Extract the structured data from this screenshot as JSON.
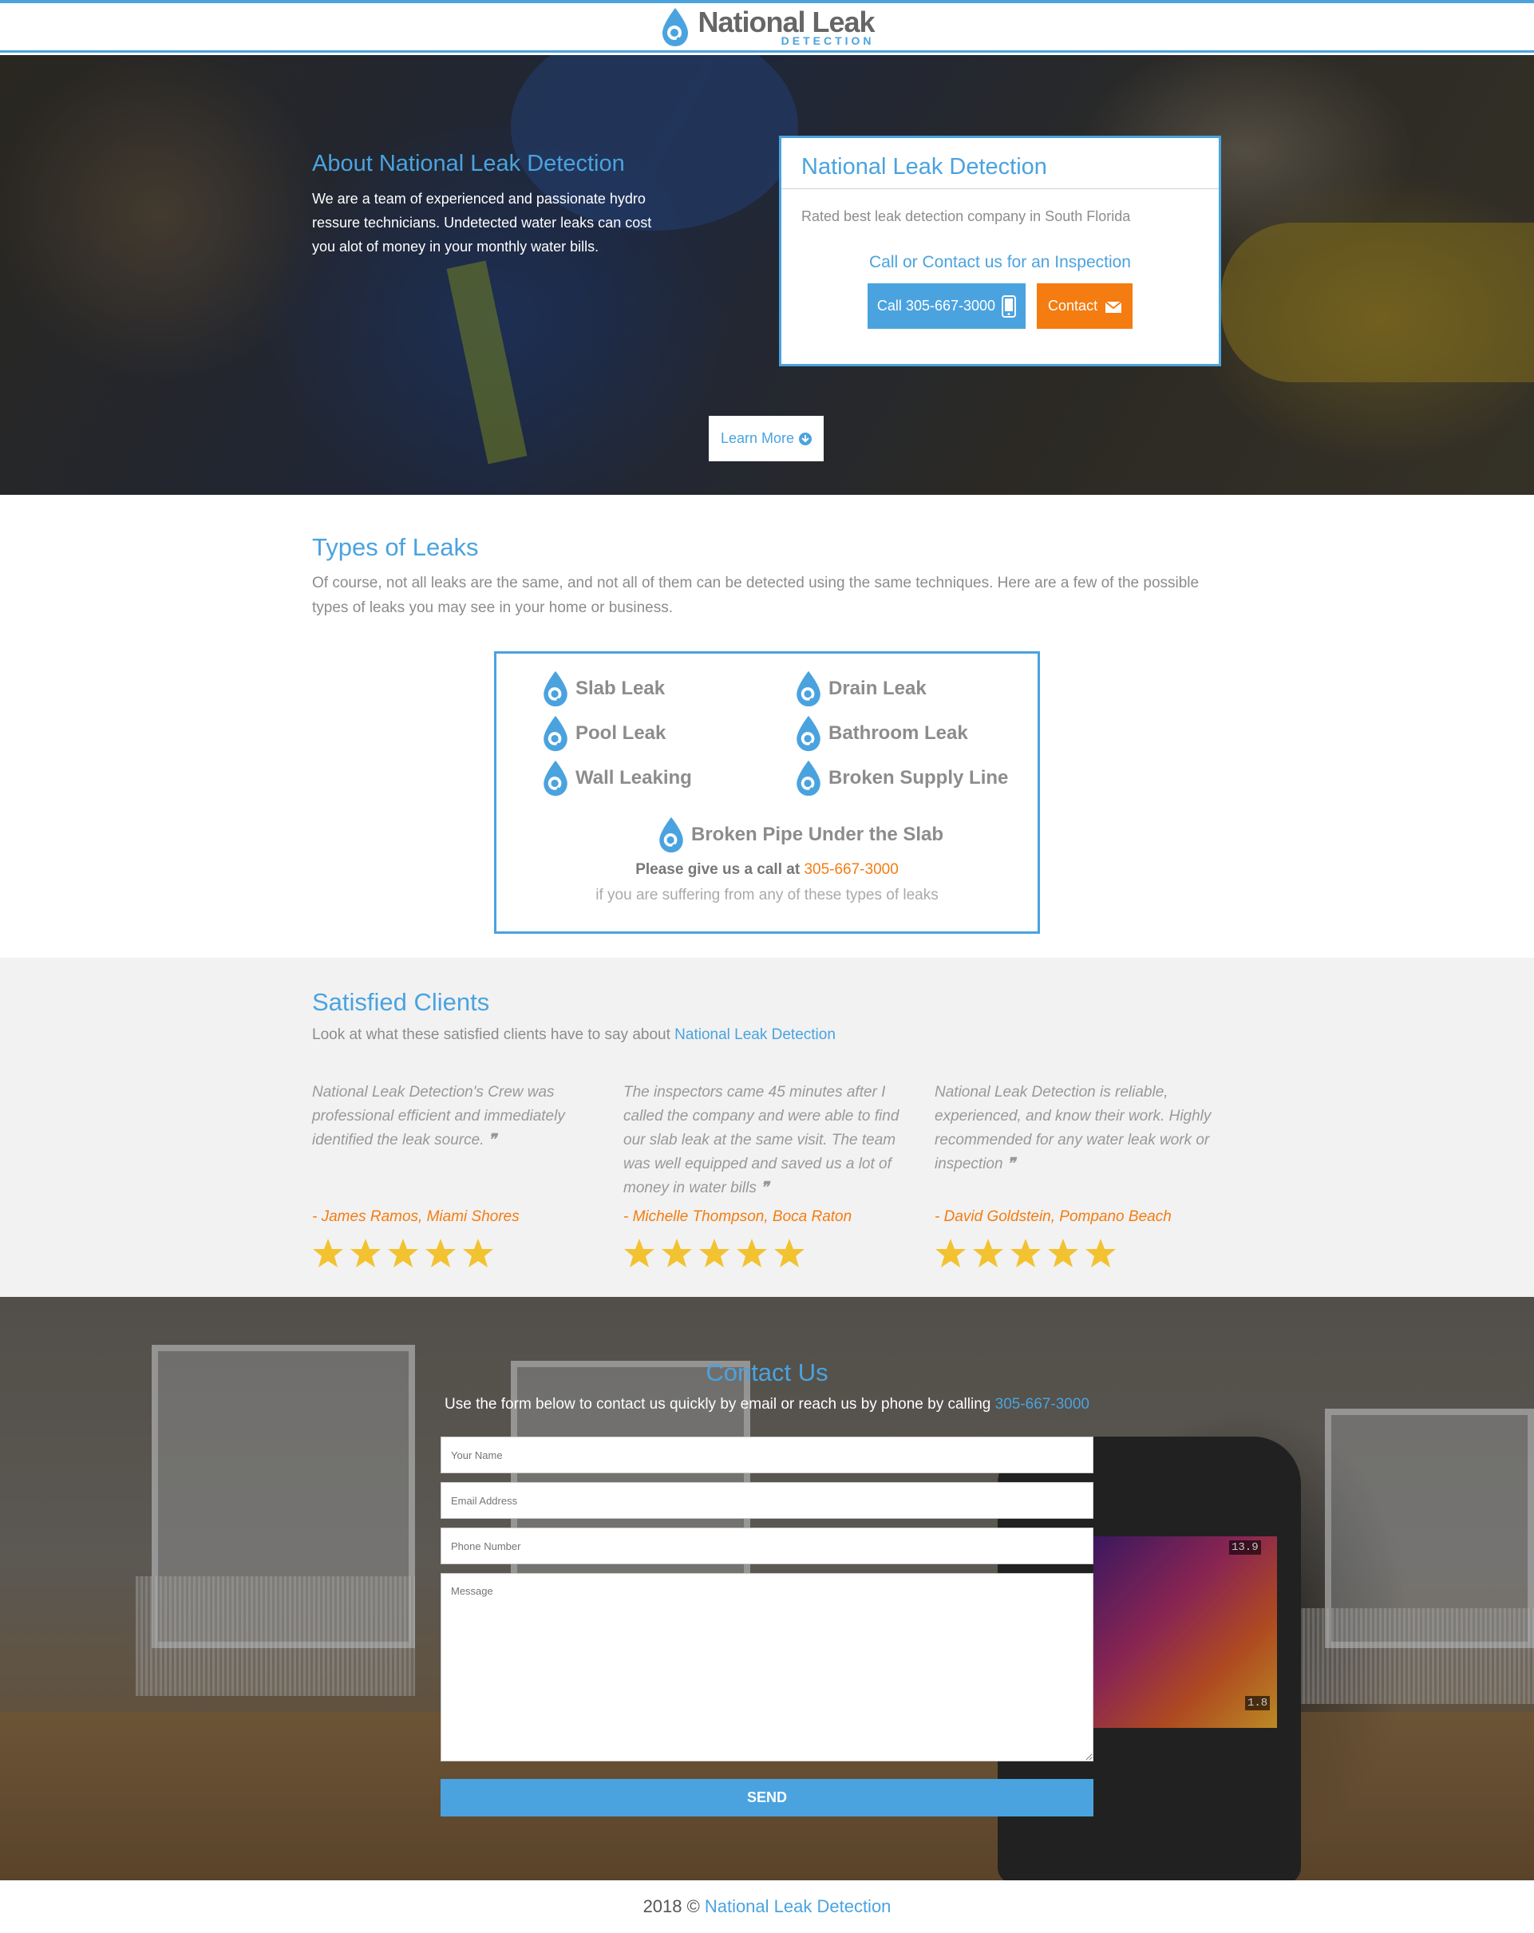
{
  "header": {
    "logo_main": "National Leak",
    "logo_sub": "DETECTION"
  },
  "hero": {
    "about_title": "About National Leak Detection",
    "about_text": "We are a team of experienced and passionate hydro ressure technicians. Undetected water leaks can cost you alot of money in your monthly water bills.",
    "cta_title": "National Leak Detection",
    "cta_rated": "Rated best leak detection company in South Florida",
    "cta_call_text": "Call or Contact us for an Inspection",
    "call_button": "Call 305-667-3000",
    "contact_button": "Contact",
    "learn_more": "Learn More"
  },
  "types": {
    "title": "Types of Leaks",
    "description": "Of course, not all leaks are the same, and not all of them can be detected using the same techniques. Here are a few of the possible types of leaks you may see in your home or business.",
    "items": [
      "Slab Leak",
      "Drain Leak",
      "Pool Leak",
      "Bathroom Leak",
      "Wall Leaking",
      "Broken Supply Line",
      "Broken Pipe Under the Slab"
    ],
    "call_prefix": "Please give us a call at",
    "call_number": "305-667-3000",
    "call_sub": "if you are suffering from any of these types of leaks"
  },
  "clients": {
    "title": "Satisfied Clients",
    "sub_prefix": "Look at what these satisfied clients have to say about",
    "sub_brand": "National Leak Detection",
    "reviews": [
      {
        "text": "National Leak Detection's Crew was professional efficient and immediately identified the leak source.",
        "author": "- James Ramos, Miami Shores",
        "rating": 5
      },
      {
        "text": "The inspectors came 45 minutes after I called the company and were able to find our slab leak at the same visit. The team was well equipped and saved us a lot of money in water bills",
        "author": "- Michelle Thompson, Boca Raton",
        "rating": 5
      },
      {
        "text": "National Leak Detection is reliable, experienced, and know their work. Highly recommended for any water leak work or inspection",
        "author": "- David Goldstein, Pompano Beach",
        "rating": 5
      }
    ]
  },
  "contact": {
    "title": "Contact Us",
    "sub_prefix": "Use the form below to contact us quickly by email or reach us by phone by calling",
    "sub_phone": "305-667-3000",
    "name_placeholder": "Your Name",
    "email_placeholder": "Email Address",
    "phone_placeholder": "Phone Number",
    "message_placeholder": "Message",
    "send_label": "SEND",
    "camera_high": "13.9",
    "camera_low": "1.8"
  },
  "footer": {
    "year": "2018 ©",
    "brand": "National Leak Detection"
  },
  "colors": {
    "accent": "#4aa3df",
    "orange": "#f47c10",
    "star": "#f2c230"
  }
}
